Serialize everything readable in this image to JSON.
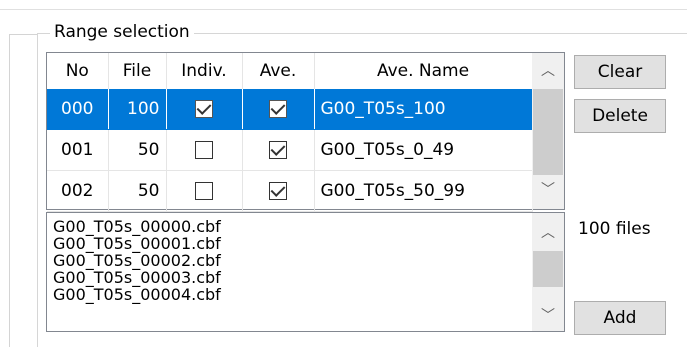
{
  "group_title": "Range selection",
  "grid": {
    "columns": [
      "No",
      "File",
      "Indiv.",
      "Ave.",
      "Ave. Name"
    ],
    "rows": [
      {
        "no": "000",
        "file": "100",
        "indiv": true,
        "ave": true,
        "name": "G00_T05s_100",
        "selected": true
      },
      {
        "no": "001",
        "file": "50",
        "indiv": false,
        "ave": true,
        "name": "G00_T05s_0_49",
        "selected": false
      },
      {
        "no": "002",
        "file": "50",
        "indiv": false,
        "ave": true,
        "name": "G00_T05s_50_99",
        "selected": false
      }
    ]
  },
  "file_list": [
    "G00_T05s_00000.cbf",
    "G00_T05s_00001.cbf",
    "G00_T05s_00002.cbf",
    "G00_T05s_00003.cbf",
    "G00_T05s_00004.cbf"
  ],
  "buttons": {
    "clear": "Clear",
    "delete": "Delete",
    "add": "Add"
  },
  "file_count": "100 files",
  "icons": {
    "scroll_up": "chevron-up-icon",
    "scroll_down": "chevron-down-icon",
    "check": "check-icon"
  }
}
